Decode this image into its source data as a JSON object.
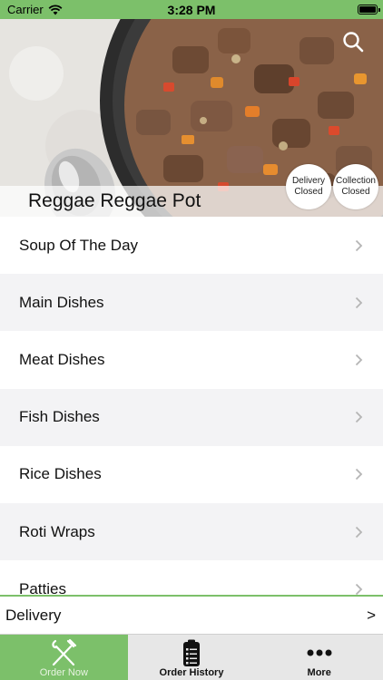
{
  "status_bar": {
    "carrier": "Carrier",
    "time": "3:28 PM"
  },
  "hero": {
    "title": "Reggae Reggae Pot",
    "delivery_status": {
      "line1": "Delivery",
      "line2": "Closed"
    },
    "collection_status": {
      "line1": "Collection",
      "line2": "Closed"
    }
  },
  "menu": {
    "items": [
      {
        "label": "Soup Of The Day"
      },
      {
        "label": "Main Dishes"
      },
      {
        "label": "Meat Dishes"
      },
      {
        "label": "Fish Dishes"
      },
      {
        "label": "Rice Dishes"
      },
      {
        "label": "Roti Wraps"
      },
      {
        "label": "Patties"
      }
    ]
  },
  "delivery_bar": {
    "label": "Delivery",
    "arrow": ">"
  },
  "tabs": [
    {
      "label": "Order Now",
      "icon": "fork-knife-icon"
    },
    {
      "label": "Order History",
      "icon": "clipboard-icon"
    },
    {
      "label": "More",
      "icon": "more-dots-icon"
    }
  ],
  "colors": {
    "accent": "#7cc06a",
    "row_alt": "#f3f3f5"
  }
}
